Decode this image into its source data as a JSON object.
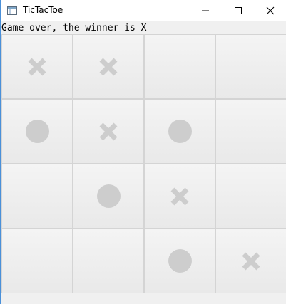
{
  "window": {
    "title": "TicTacToe",
    "icon": "app-window-icon",
    "controls": [
      "minimize-icon",
      "maximize-icon",
      "close-icon"
    ]
  },
  "status_text": "Game over, the winner is X",
  "colors": {
    "mark": "#cdcdcd",
    "cell_border": "#d4d4d4",
    "background": "#f0f0f0"
  },
  "board": [
    [
      "X",
      "X",
      "",
      ""
    ],
    [
      "O",
      "X",
      "O",
      ""
    ],
    [
      "",
      "O",
      "X",
      ""
    ],
    [
      "",
      "",
      "O",
      "X"
    ]
  ]
}
